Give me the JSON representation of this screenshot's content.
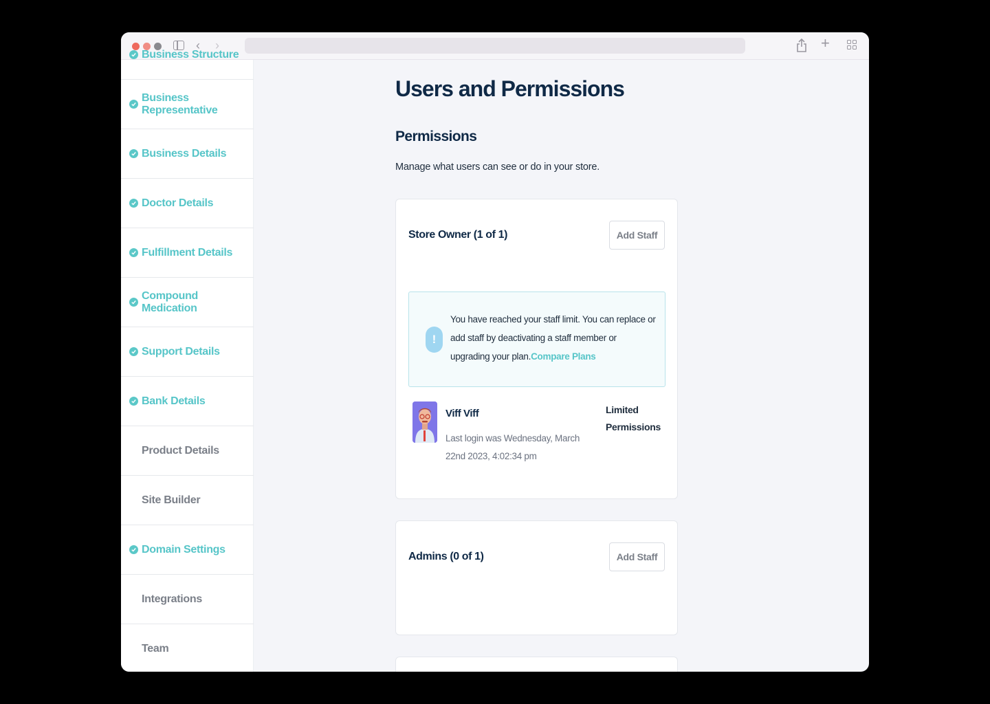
{
  "browser": {
    "icons": [
      "sidebar-toggle-icon",
      "back-icon",
      "forward-icon",
      "share-icon",
      "new-tab-icon",
      "tab-overview-icon"
    ]
  },
  "sidebar": {
    "items": [
      {
        "label": "Business Structure",
        "done": true
      },
      {
        "label": "Business Representative",
        "done": true
      },
      {
        "label": "Business Details",
        "done": true
      },
      {
        "label": "Doctor Details",
        "done": true
      },
      {
        "label": "Fulfillment Details",
        "done": true
      },
      {
        "label": "Compound Medication",
        "done": true
      },
      {
        "label": "Support Details",
        "done": true
      },
      {
        "label": "Bank Details",
        "done": true
      },
      {
        "label": "Product Details",
        "done": false
      },
      {
        "label": "Site Builder",
        "done": false
      },
      {
        "label": "Domain Settings",
        "done": true
      },
      {
        "label": "Integrations",
        "done": false
      },
      {
        "label": "Team",
        "done": false
      }
    ]
  },
  "main": {
    "title": "Users and Permissions",
    "section_title": "Permissions",
    "section_desc": "Manage what users can see or do in your store.",
    "store_owner": {
      "title": "Store Owner (1 of 1)",
      "add_label": "Add Staff",
      "alert_text": "You have reached your staff limit. You can replace or add staff by deactivating a staff member or upgrading your plan.",
      "alert_link": "Compare Plans",
      "user": {
        "name": "Viff Viff",
        "last_login": "Last login was Wednesday, March 22nd 2023, 4:02:34 pm",
        "role": "Limited Permissions"
      }
    },
    "admins": {
      "title": "Admins (0 of 1)",
      "add_label": "Add Staff"
    }
  },
  "colors": {
    "accent": "#56c5c8",
    "heading": "#0f2946",
    "muted": "#7a7f88"
  }
}
